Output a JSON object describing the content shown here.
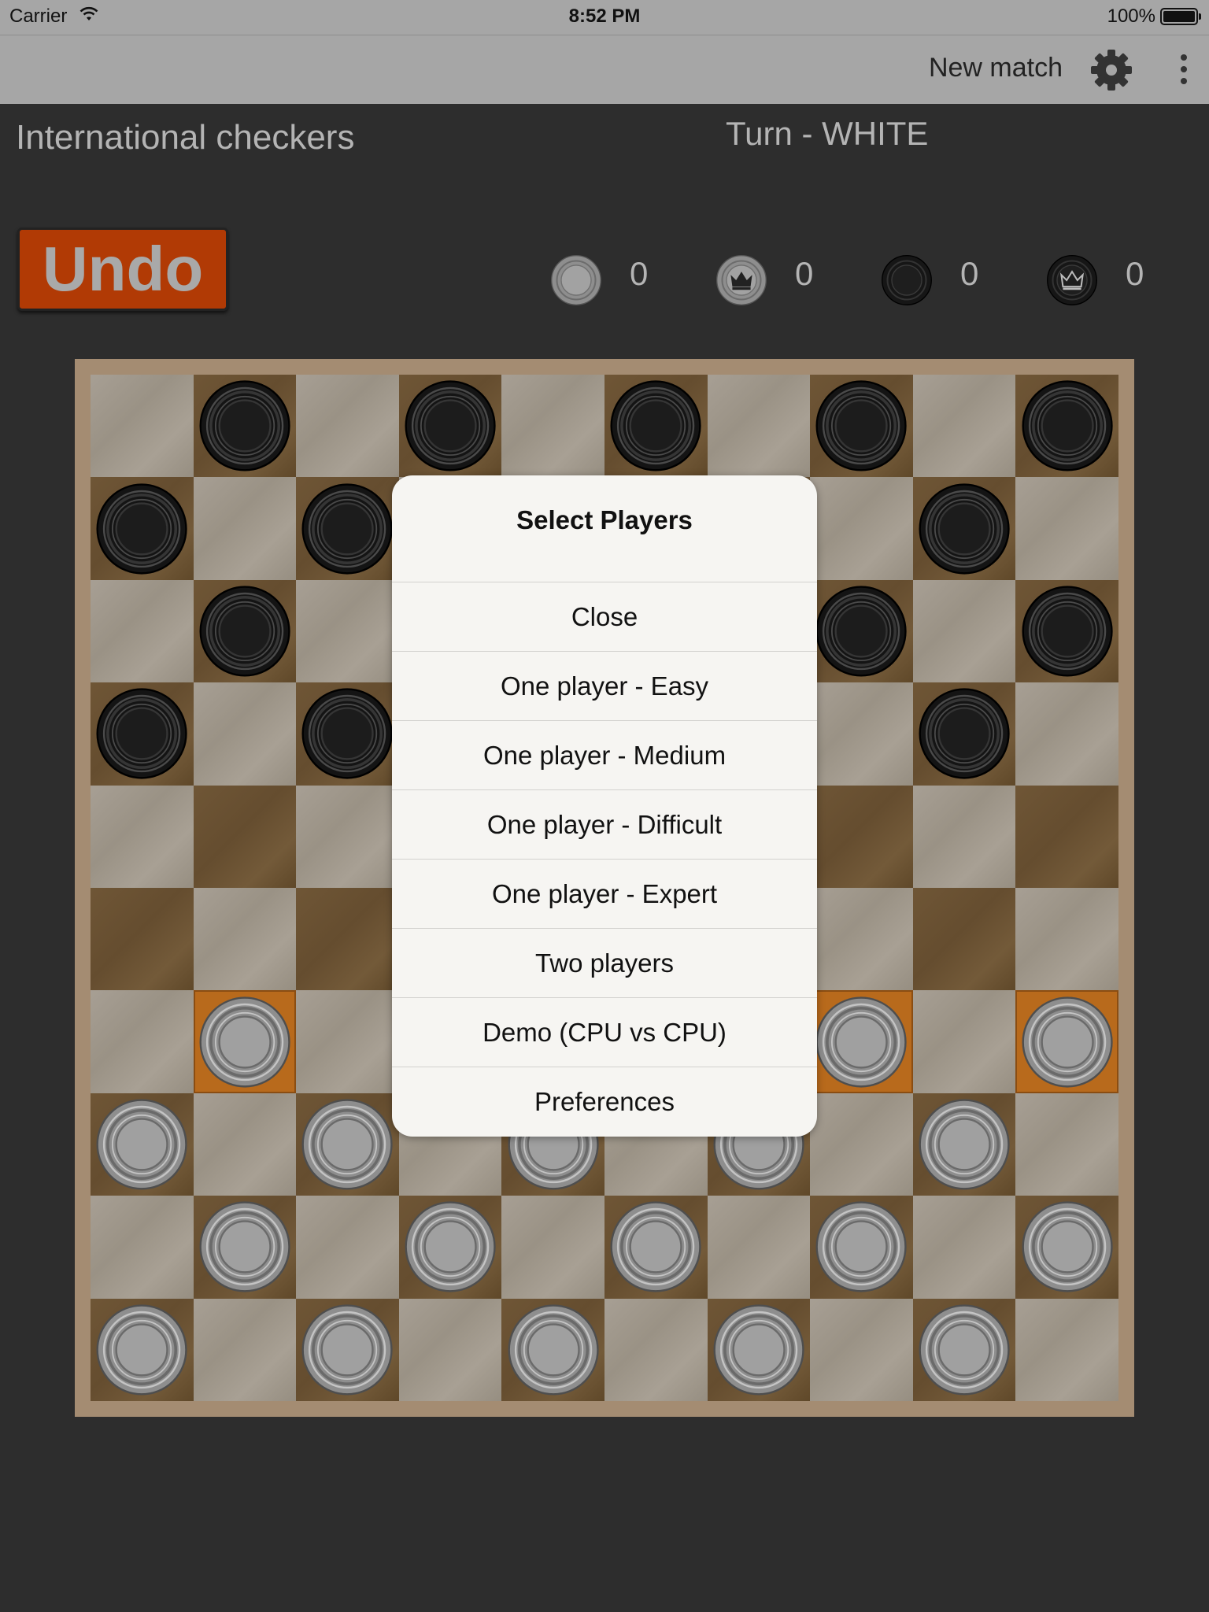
{
  "status_bar": {
    "carrier": "Carrier",
    "time": "8:52 PM",
    "battery": "100%"
  },
  "nav": {
    "new_match": "New match",
    "settings_icon": "gear-icon",
    "more_icon": "more-vertical-icon"
  },
  "header": {
    "title": "International checkers",
    "turn": "Turn - WHITE"
  },
  "undo_label": "Undo",
  "captured": [
    {
      "piece": "white-man",
      "count": "0"
    },
    {
      "piece": "white-king",
      "count": "0"
    },
    {
      "piece": "black-man",
      "count": "0"
    },
    {
      "piece": "black-king",
      "count": "0"
    }
  ],
  "board": {
    "size": 10,
    "rows": [
      "-b-b-b-b-b",
      "b-b-----b-",
      "-b-----b-b",
      "b-b-----b-",
      "----------",
      "----------",
      "-w-----w-w",
      "w-w-w-w-w-",
      "-w-w-w-w-w",
      "w-w-w-w-w-"
    ],
    "highlighted": [
      [
        6,
        1
      ],
      [
        6,
        7
      ],
      [
        6,
        9
      ]
    ]
  },
  "colors": {
    "background": "#2d2d2d",
    "bar": "#a6a6a6",
    "undo": "#b13a05",
    "board_frame": "#a48c72",
    "highlight": "#b86a1c",
    "white_piece": "#9a9a9a",
    "black_piece": "#1c1c1c"
  },
  "dialog": {
    "title": "Select Players",
    "items": [
      "Close",
      "One player - Easy",
      "One player - Medium",
      "One player - Difficult",
      "One player - Expert",
      "Two players",
      "Demo (CPU vs CPU)",
      "Preferences"
    ]
  }
}
